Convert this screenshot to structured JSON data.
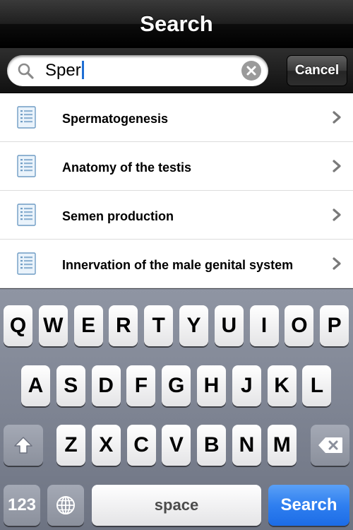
{
  "nav": {
    "title": "Search"
  },
  "search": {
    "query": "Sper",
    "cancel_label": "Cancel"
  },
  "results": [
    {
      "label": "Spermatogenesis"
    },
    {
      "label": "Anatomy of the testis"
    },
    {
      "label": "Semen production"
    },
    {
      "label": "Innervation of the male genital system"
    }
  ],
  "keyboard": {
    "row1": [
      "Q",
      "W",
      "E",
      "R",
      "T",
      "Y",
      "U",
      "I",
      "O",
      "P"
    ],
    "row2": [
      "A",
      "S",
      "D",
      "F",
      "G",
      "H",
      "J",
      "K",
      "L"
    ],
    "row3": [
      "Z",
      "X",
      "C",
      "V",
      "B",
      "N",
      "M"
    ],
    "numbers_label": "123",
    "space_label": "space",
    "search_label": "Search"
  },
  "colors": {
    "accent": "#1c6ce6",
    "caret": "#1f6ed4"
  },
  "icons": [
    "search-icon",
    "clear-icon",
    "document-icon",
    "chevron-right-icon",
    "shift-icon",
    "backspace-icon",
    "globe-icon"
  ]
}
